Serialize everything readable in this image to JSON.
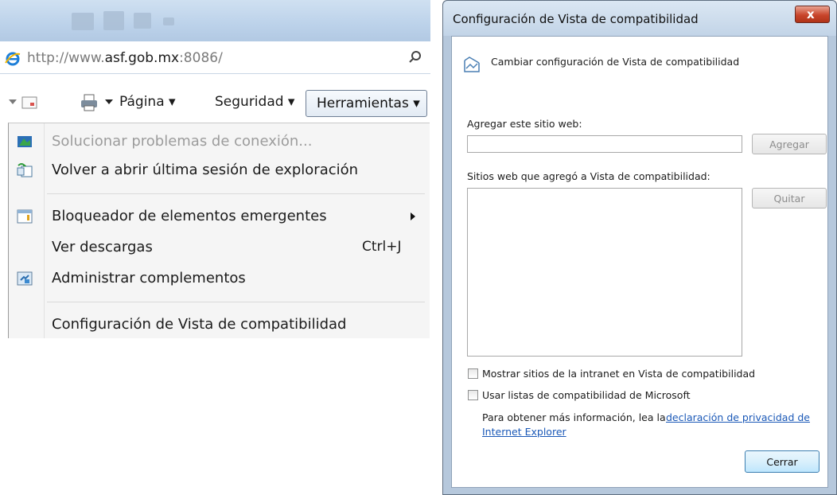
{
  "browser": {
    "address": {
      "url_prefix": "http://www.",
      "url_domain": "asf.gob.mx",
      "url_suffix": ":8086/"
    },
    "command_bar": {
      "page_label": "Página ▾",
      "security_label": "Seguridad ▾",
      "tools_label": "Herramientas ▾"
    },
    "tools_menu": {
      "items": [
        {
          "label": "Solucionar problemas de conexión...",
          "enabled": false,
          "icon": "network-diagnostics-icon"
        },
        {
          "label": "Volver a abrir última sesión de exploración",
          "enabled": true,
          "icon": "reopen-session-icon"
        },
        {
          "label": "Bloqueador de elementos emergentes",
          "enabled": true,
          "icon": "popup-blocker-icon",
          "submenu": true
        },
        {
          "label": "Ver descargas",
          "enabled": true,
          "shortcut": "Ctrl+J"
        },
        {
          "label": "Administrar complementos",
          "enabled": true,
          "icon": "manage-addons-icon"
        },
        {
          "label": "Configuración de Vista de compatibilidad",
          "enabled": true
        }
      ]
    }
  },
  "dialog": {
    "title": "Configuración de Vista de compatibilidad",
    "close_glyph": "x",
    "header": "Cambiar configuración de Vista de compatibilidad",
    "add_site_label": "Agregar este sitio web:",
    "add_site_value": "",
    "add_button": "Agregar",
    "list_label": "Sitios web que agregó a Vista de compatibilidad:",
    "remove_button": "Quitar",
    "checkbox_intranet": {
      "label": "Mostrar sitios de la intranet en Vista de compatibilidad",
      "checked": false
    },
    "checkbox_microsoft": {
      "label": "Usar listas de compatibilidad de Microsoft",
      "checked": false
    },
    "info_text": "Para obtener más información, lea la",
    "privacy_link_1": "declaración de privacidad de",
    "privacy_link_2": "Internet Explorer",
    "close_button": "Cerrar"
  }
}
